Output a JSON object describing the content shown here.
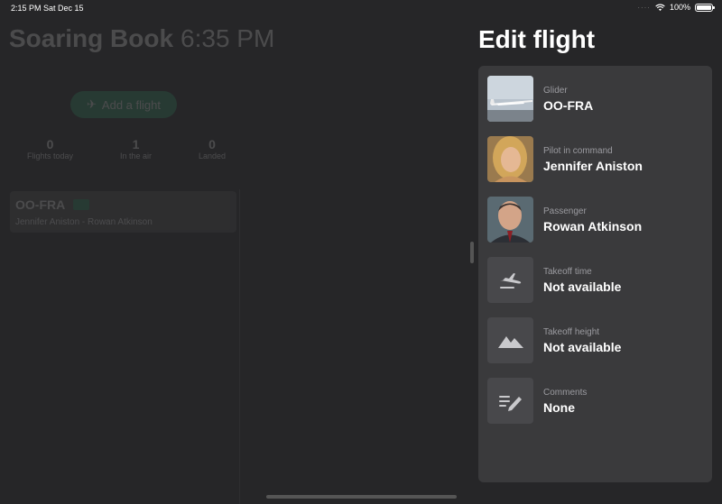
{
  "status_bar": {
    "time": "2:15 PM",
    "date": "Sat Dec 15",
    "battery": "100%"
  },
  "background": {
    "title": "Soaring Book",
    "clock": "6:35 PM",
    "add_button": "Add a flight",
    "stats": [
      {
        "value": "0",
        "label": "Flights today"
      },
      {
        "value": "1",
        "label": "In the air"
      },
      {
        "value": "0",
        "label": "Landed"
      }
    ],
    "flight_card": {
      "registration": "OO-FRA",
      "crew": "Jennifer Aniston - Rowan Atkinson"
    }
  },
  "edit_panel": {
    "title": "Edit flight",
    "rows": [
      {
        "label": "Glider",
        "value": "OO-FRA",
        "icon": "glider-photo"
      },
      {
        "label": "Pilot in command",
        "value": "Jennifer Aniston",
        "icon": "pilot-avatar"
      },
      {
        "label": "Passenger",
        "value": "Rowan Atkinson",
        "icon": "passenger-avatar"
      },
      {
        "label": "Takeoff time",
        "value": "Not available",
        "icon": "takeoff-icon"
      },
      {
        "label": "Takeoff height",
        "value": "Not available",
        "icon": "mountain-icon"
      },
      {
        "label": "Comments",
        "value": "None",
        "icon": "edit-notes-icon"
      }
    ]
  },
  "colors": {
    "accent_green": "#2f9e6a",
    "panel_bg": "#3a3a3c",
    "page_bg": "#262628"
  }
}
